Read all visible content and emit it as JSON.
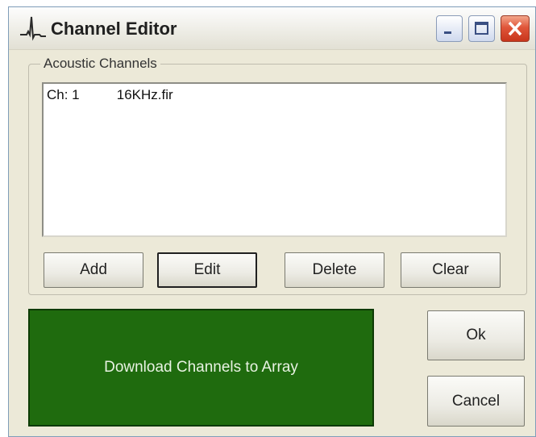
{
  "window": {
    "title": "Channel Editor",
    "icon": "waveform-icon",
    "controls": [
      "minimize-icon",
      "maximize-icon",
      "close-icon"
    ]
  },
  "group": {
    "label": "Acoustic Channels"
  },
  "channels": {
    "items": [
      {
        "channel": "Ch: 1",
        "file": "16KHz.fir"
      }
    ]
  },
  "buttons": {
    "add": "Add",
    "edit": "Edit",
    "delete": "Delete",
    "clear": "Clear",
    "download": "Download Channels to Array",
    "ok": "Ok",
    "cancel": "Cancel"
  },
  "colors": {
    "download_bg": "#1f6b0e",
    "download_text": "#e8f2e2",
    "close_button": "#e0563a"
  }
}
